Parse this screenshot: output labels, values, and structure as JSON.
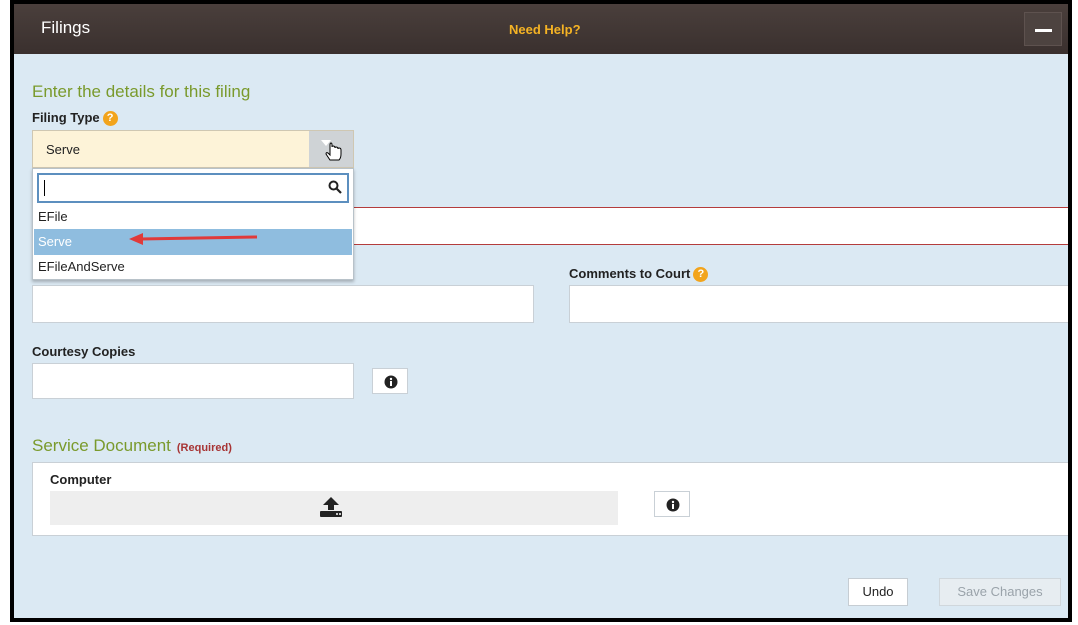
{
  "panel": {
    "title": "Filings",
    "help_link": "Need Help?"
  },
  "details_heading": "Enter the details for this filing",
  "filing_type": {
    "label": "Filing Type",
    "help_icon": "?",
    "selected": "Serve",
    "search_value": "",
    "options": [
      "EFile",
      "Serve",
      "EFileAndServe"
    ],
    "highlighted_option": "Serve"
  },
  "comments_to_court": {
    "label": "Comments to Court",
    "help_icon": "?",
    "value": ""
  },
  "courtesy_copies": {
    "label": "Courtesy Copies",
    "value": ""
  },
  "service_document": {
    "heading": "Service Document",
    "required_tag": "(Required)",
    "source_label": "Computer"
  },
  "buttons": {
    "undo": "Undo",
    "save": "Save Changes"
  },
  "colors": {
    "titlebar": "#3e3432",
    "panel_bg": "#dbe9f3",
    "accent_green": "#7a9a2c",
    "help_orange": "#f5b324",
    "selected_option": "#8fbddf",
    "error_border": "#b43c3c",
    "annotation_arrow": "#e03a3a"
  }
}
